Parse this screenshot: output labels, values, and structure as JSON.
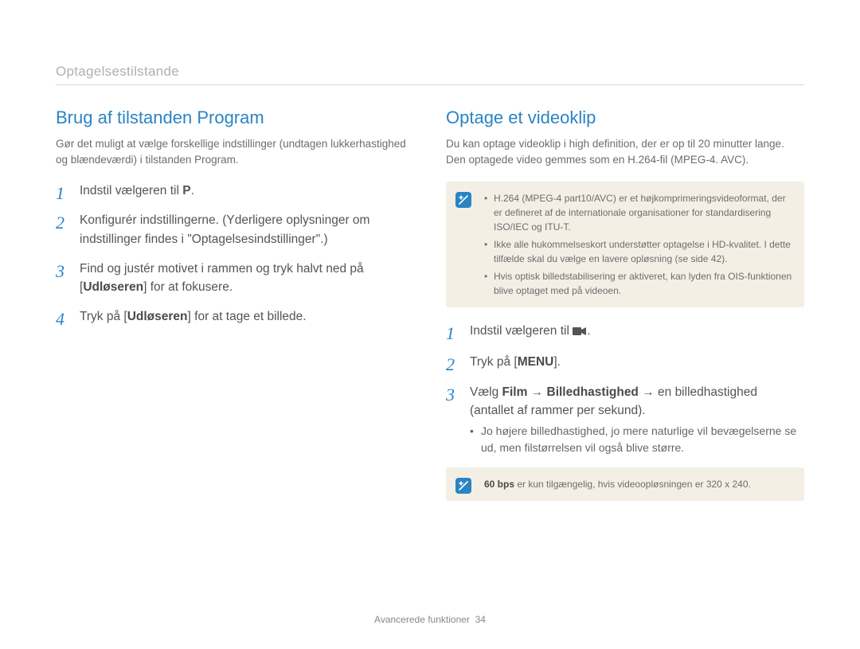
{
  "breadcrumb": "Optagelsestilstande",
  "left": {
    "title": "Brug af tilstanden Program",
    "intro": "Gør det muligt at vælge forskellige indstillinger (undtagen lukkerhastighed og blændeværdi) i tilstanden Program.",
    "steps": {
      "s1_pre": "Indstil vælgeren til ",
      "s1_post": ".",
      "s2": "Konfigurér indstillingerne. (Yderligere oplysninger om indstillinger findes i \"Optagelsesindstillinger\".)",
      "s3_pre": "Find og justér motivet i rammen og tryk halvt ned på [",
      "s3_bold": "Udløseren",
      "s3_post": "] for at fokusere.",
      "s4_pre": "Tryk på [",
      "s4_bold": "Udløseren",
      "s4_post": "] for at tage et billede."
    }
  },
  "right": {
    "title": "Optage et videoklip",
    "intro": "Du kan optage videoklip i high definition, der er op til 20 minutter lange. Den optagede video gemmes som en H.264-fil (MPEG-4. AVC).",
    "note1": {
      "b1": "H.264 (MPEG-4 part10/AVC) er et højkomprimeringsvideoformat, der er defineret af de internationale organisationer for standardisering ISO/IEC og ITU-T.",
      "b2": "Ikke alle hukommelseskort understøtter optagelse i HD-kvalitet. I dette tilfælde skal du vælge en lavere opløsning (se side 42).",
      "b3": "Hvis optisk billedstabilisering er aktiveret, kan lyden fra OIS-funktionen blive optaget med på videoen."
    },
    "steps": {
      "s1_pre": "Indstil vælgeren til ",
      "s1_post": ".",
      "s2_pre": "Tryk på [",
      "s2_bold": "MENU",
      "s2_post": "].",
      "s3_pre": "Vælg ",
      "s3_b1": "Film",
      "s3_arrow": " → ",
      "s3_b2": "Billedhastighed",
      "s3_b3": " → en billedhastighed (antallet af rammer per sekund).",
      "s3_sub": "Jo højere billedhastighed, jo mere naturlige vil bevægelserne se ud, men filstørrelsen vil også blive større."
    },
    "note2_bold": "60 bps",
    "note2_rest": " er kun tilgængelig, hvis videoopløsningen er 320 x 240."
  },
  "footer_label": "Avancerede funktioner",
  "footer_page": "34"
}
